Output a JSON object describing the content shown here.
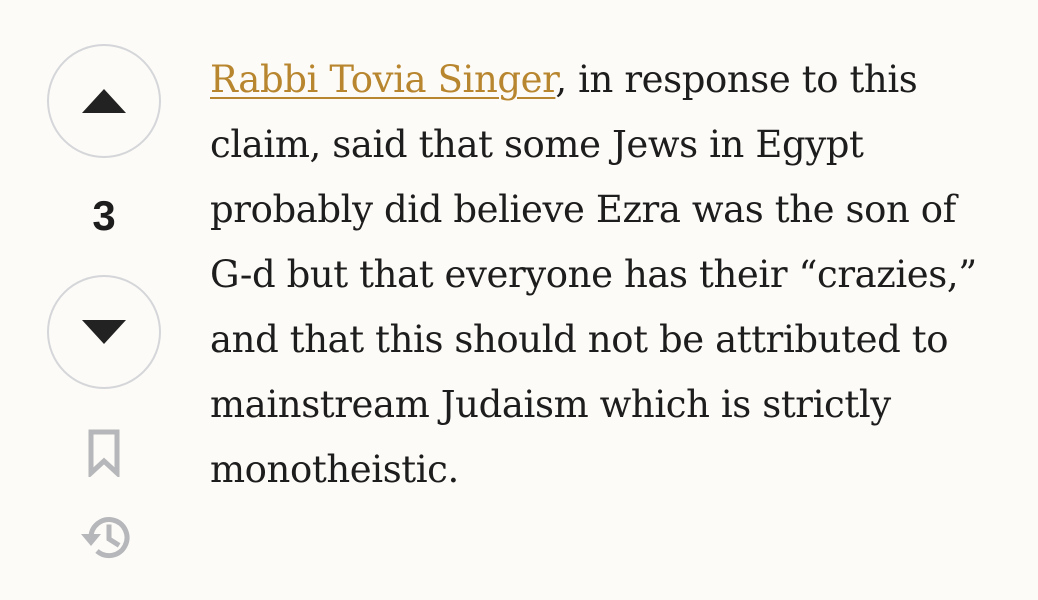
{
  "votes": {
    "count": "3",
    "upvote_icon": "triangle-up-icon",
    "downvote_icon": "triangle-down-icon"
  },
  "actions": {
    "bookmark_icon": "bookmark-icon",
    "history_icon": "history-icon"
  },
  "paragraph": {
    "link_text": "Rabbi Tovia Singer",
    "text": ", in response to this claim, said that some Jews in Egypt probably did believe Ezra was the son of G-d but that everyone has their “crazies,” and that this should not be attributed to mainstream Judaism which is strictly monotheistic."
  },
  "colors": {
    "background": "#fdfbf7",
    "link": "#b8862f",
    "text": "#1d1d1d",
    "icon_dark": "#222222",
    "icon_muted": "#b5b7ba",
    "border": "#d4d6d9"
  }
}
